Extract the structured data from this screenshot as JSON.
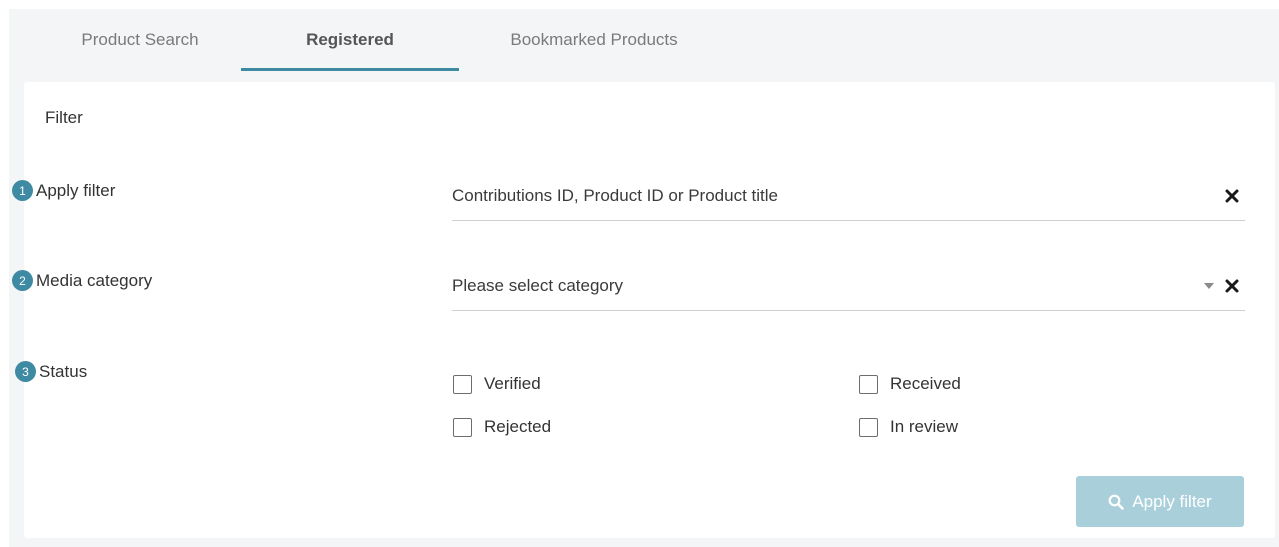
{
  "tabs": [
    {
      "label": "Product Search",
      "active": false
    },
    {
      "label": "Registered",
      "active": true
    },
    {
      "label": "Bookmarked Products",
      "active": false
    }
  ],
  "filter": {
    "title": "Filter",
    "rows": [
      {
        "number": "1",
        "label": "Apply filter"
      },
      {
        "number": "2",
        "label": "Media category"
      },
      {
        "number": "3",
        "label": "Status"
      }
    ],
    "search_placeholder": "Contributions ID, Product ID or Product title",
    "category_placeholder": "Please select category",
    "status_options": [
      "Verified",
      "Received",
      "Rejected",
      "In review"
    ],
    "apply_label": "Apply filter"
  },
  "colors": {
    "accent": "#3f8aa3",
    "button_disabled": "#a9cfdb",
    "background": "#f4f5f7"
  },
  "icons": [
    "close-icon",
    "caret-down-icon",
    "search-icon"
  ]
}
